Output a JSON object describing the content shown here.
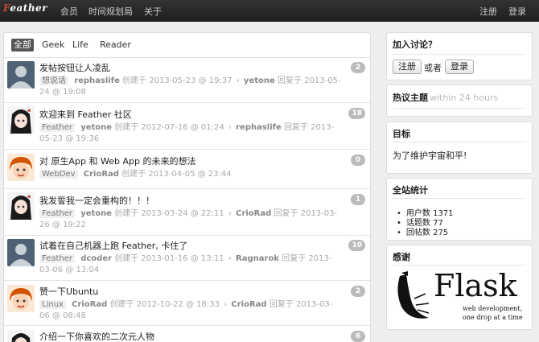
{
  "nav": {
    "brand": {
      "prefix": "F",
      "rest": "eather"
    },
    "links": [
      "会员",
      "时间规划局",
      "关于"
    ],
    "register": "注册",
    "login": "登录"
  },
  "tabs": [
    "全部",
    "Geek",
    "Life",
    "Reader"
  ],
  "topics": [
    {
      "title": "发帖按钮让人凌乱",
      "node": "想说话",
      "author": "rephaslife",
      "created_label": "创建于",
      "created": "2013-05-23 @ 19:37",
      "last_user": "yetone",
      "reply_label": "回复于",
      "replied": "2013-05-24 @ 19:08",
      "count": "2",
      "avatar": "default"
    },
    {
      "title": "欢迎来到 Feather 社区",
      "node": "Feather",
      "author": "yetone",
      "created_label": "创建于",
      "created": "2012-07-16 @ 01:24",
      "last_user": "rephaslife",
      "reply_label": "回复于",
      "replied": "2013-05-23 @ 19:36",
      "count": "18",
      "avatar": "anime"
    },
    {
      "title": "对 原生App 和 Web App 的未来的想法",
      "node": "WebDev",
      "author": "CrioRad",
      "created_label": "创建于",
      "created": "2013-04-05 @ 23:44",
      "last_user": "",
      "reply_label": "",
      "replied": "",
      "count": "0",
      "avatar": "cartoon"
    },
    {
      "title": "我发誓我一定会重构的！！！",
      "node": "Feather",
      "author": "yetone",
      "created_label": "创建于",
      "created": "2013-03-24 @ 22:11",
      "last_user": "CrioRad",
      "reply_label": "回复于",
      "replied": "2013-03-26 @ 19:22",
      "count": "1",
      "avatar": "anime"
    },
    {
      "title": "试着在自己机器上跑 Feather, 卡住了",
      "node": "Feather",
      "author": "dcoder",
      "created_label": "创建于",
      "created": "2013-01-16 @ 13:11",
      "last_user": "Ragnarok",
      "reply_label": "回复于",
      "replied": "2013-03-06 @ 13:04",
      "count": "10",
      "avatar": "default"
    },
    {
      "title": "赞一下Ubuntu",
      "node": "Linux",
      "author": "CrioRad",
      "created_label": "创建于",
      "created": "2012-10-22 @ 18:33",
      "last_user": "CrioRad",
      "reply_label": "回复于",
      "replied": "2013-03-06 @ 08:48",
      "count": "2",
      "avatar": "cartoon"
    },
    {
      "title": "介绍一下你喜欢的二次元人物",
      "node": "",
      "author": "",
      "created_label": "",
      "created": "",
      "last_user": "",
      "reply_label": "",
      "replied": "",
      "count": "6",
      "avatar": "anime"
    }
  ],
  "sidebar": {
    "join": {
      "title": "加入讨论？",
      "register": "注册",
      "or": "或者",
      "login": "登录"
    },
    "hot": {
      "title": "热议主题",
      "subtitle": "within 24 hours"
    },
    "goal": {
      "title": "目标",
      "text": "为了维护宇宙和平!"
    },
    "stats": {
      "title": "全站统计",
      "items": [
        "用户数 1371",
        "话题数 77",
        "回帖数 275"
      ]
    },
    "thanks": {
      "title": "感谢",
      "logo_word": "Flask",
      "logo_tag1": "web development,",
      "logo_tag2": "one drop at a time"
    }
  },
  "colors": {
    "topbar": "#222222",
    "brand_accent": "#d14836",
    "badge": "#bbbbbb",
    "active_tab": "#555555"
  }
}
